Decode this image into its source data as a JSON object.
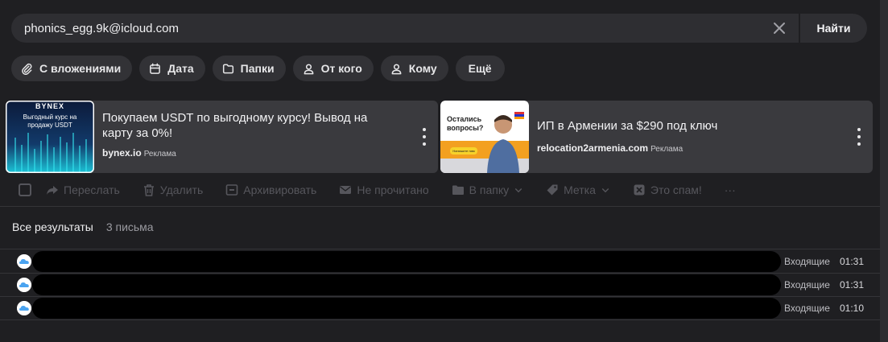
{
  "search": {
    "value": "phonics_egg.9k@icloud.com",
    "button_label": "Найти"
  },
  "filters": [
    {
      "label": "С вложениями",
      "icon": "paperclip-icon"
    },
    {
      "label": "Дата",
      "icon": "calendar-icon"
    },
    {
      "label": "Папки",
      "icon": "folder-icon"
    },
    {
      "label": "От кого",
      "icon": "person-icon"
    },
    {
      "label": "Кому",
      "icon": "person-icon"
    },
    {
      "label": "Ещё",
      "icon": ""
    }
  ],
  "ads": [
    {
      "image_text_top": "BYNEX",
      "image_text": "Выгодный курс на продажу USDT",
      "title": "Покупаем USDT по выгодному курсу! Вывод на карту за 0%!",
      "source": "bynex.io",
      "label": "Реклама"
    },
    {
      "image_text": "Остались вопросы?",
      "image_button": "Напишите нам",
      "title": "ИП в Армении за $290 под ключ",
      "source": "relocation2armenia.com",
      "label": "Реклама"
    }
  ],
  "toolbar": {
    "forward": "Переслать",
    "delete": "Удалить",
    "archive": "Архивировать",
    "unread": "Не прочитано",
    "to_folder": "В папку",
    "label": "Метка",
    "spam": "Это спам!",
    "more": "···"
  },
  "results": {
    "all_label": "Все результаты",
    "count_label": "3 письма",
    "rows": [
      {
        "folder": "Входящие",
        "time": "01:31"
      },
      {
        "folder": "Входящие",
        "time": "01:31"
      },
      {
        "folder": "Входящие",
        "time": "01:10"
      }
    ]
  },
  "colors": {
    "background": "#1f1f22",
    "chip": "#323236",
    "ad_card": "#3a3a3e",
    "toolbar_disabled": "#56565c"
  }
}
